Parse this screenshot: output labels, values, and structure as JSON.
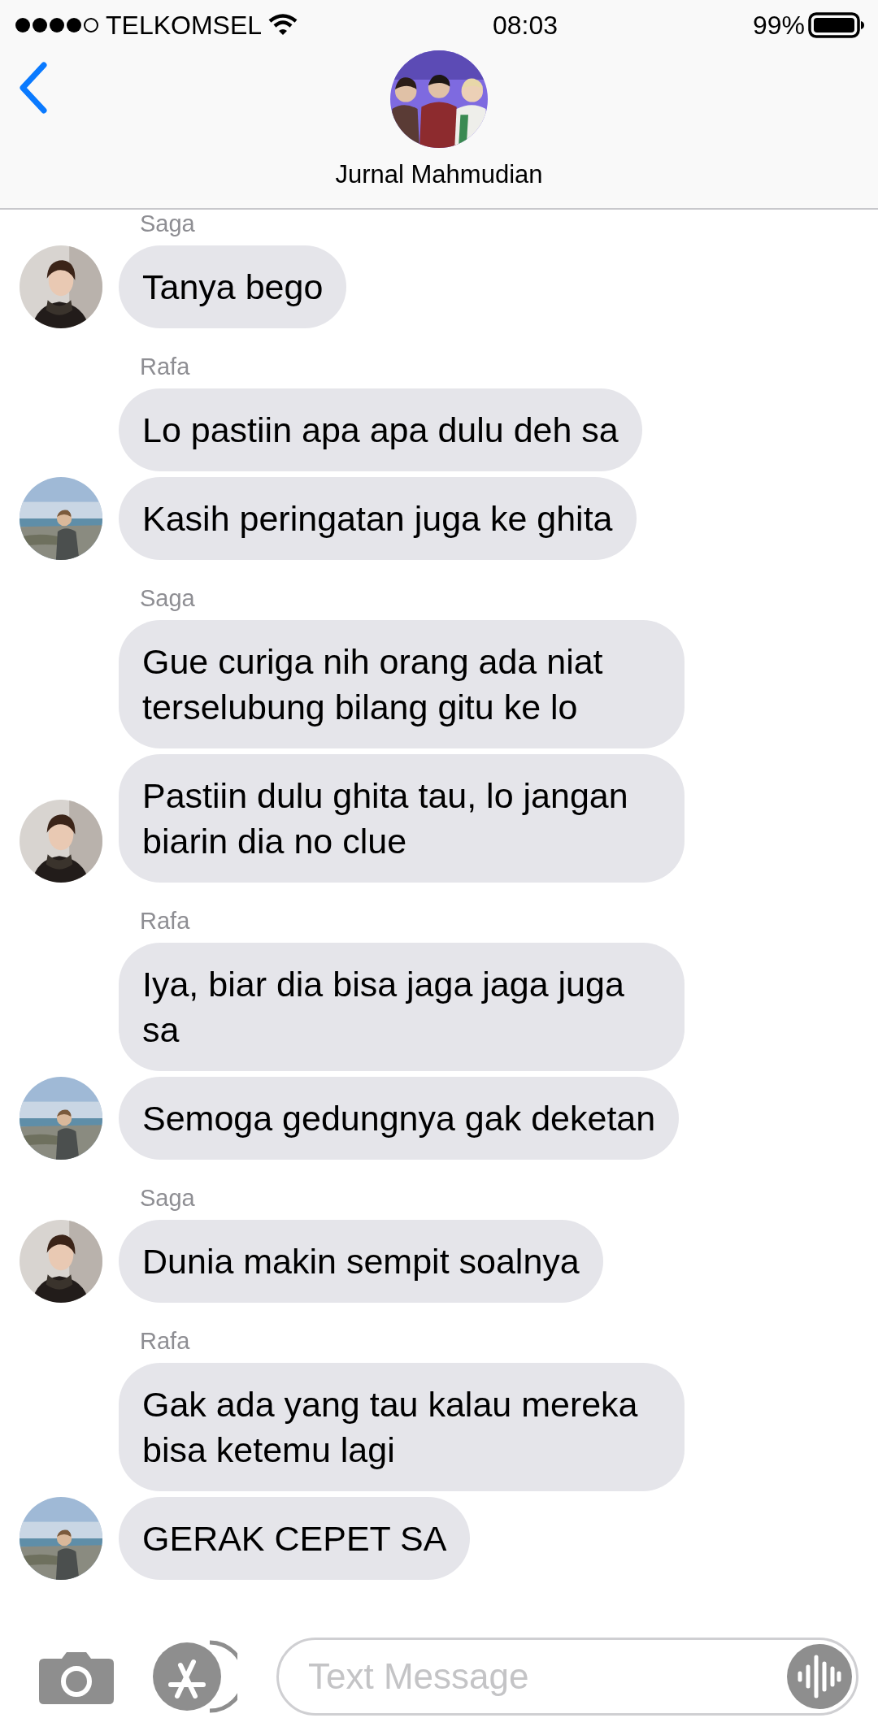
{
  "status_bar": {
    "carrier": "TELKOMSEL",
    "time": "08:03",
    "battery": "99%"
  },
  "header": {
    "title": "Jurnal Mahmudian",
    "avatar": {
      "kind": "picture"
    }
  },
  "groups": [
    {
      "sender": "Saga",
      "avatar": {
        "kind": "picture"
      },
      "messages": [
        "Tanya bego"
      ]
    },
    {
      "sender": "Rafa",
      "avatar": {
        "kind": "picture"
      },
      "messages": [
        "Lo pastiin apa apa dulu deh sa",
        "Kasih peringatan juga ke ghita"
      ]
    },
    {
      "sender": "Saga",
      "avatar": {
        "kind": "picture"
      },
      "messages": [
        "Gue curiga nih orang ada niat terselubung bilang gitu ke lo",
        "Pastiin dulu ghita tau, lo jangan biarin dia no clue"
      ]
    },
    {
      "sender": "Rafa",
      "avatar": {
        "kind": "picture"
      },
      "messages": [
        "Iya, biar dia bisa jaga jaga juga sa",
        "Semoga gedungnya gak deketan"
      ]
    },
    {
      "sender": "Saga",
      "avatar": {
        "kind": "picture"
      },
      "messages": [
        "Dunia makin sempit soalnya"
      ]
    },
    {
      "sender": "Rafa",
      "avatar": {
        "kind": "picture"
      },
      "messages": [
        "Gak ada yang tau kalau mereka bisa ketemu lagi",
        "GERAK CEPET SA"
      ]
    }
  ],
  "composer": {
    "placeholder": "Text Message"
  }
}
